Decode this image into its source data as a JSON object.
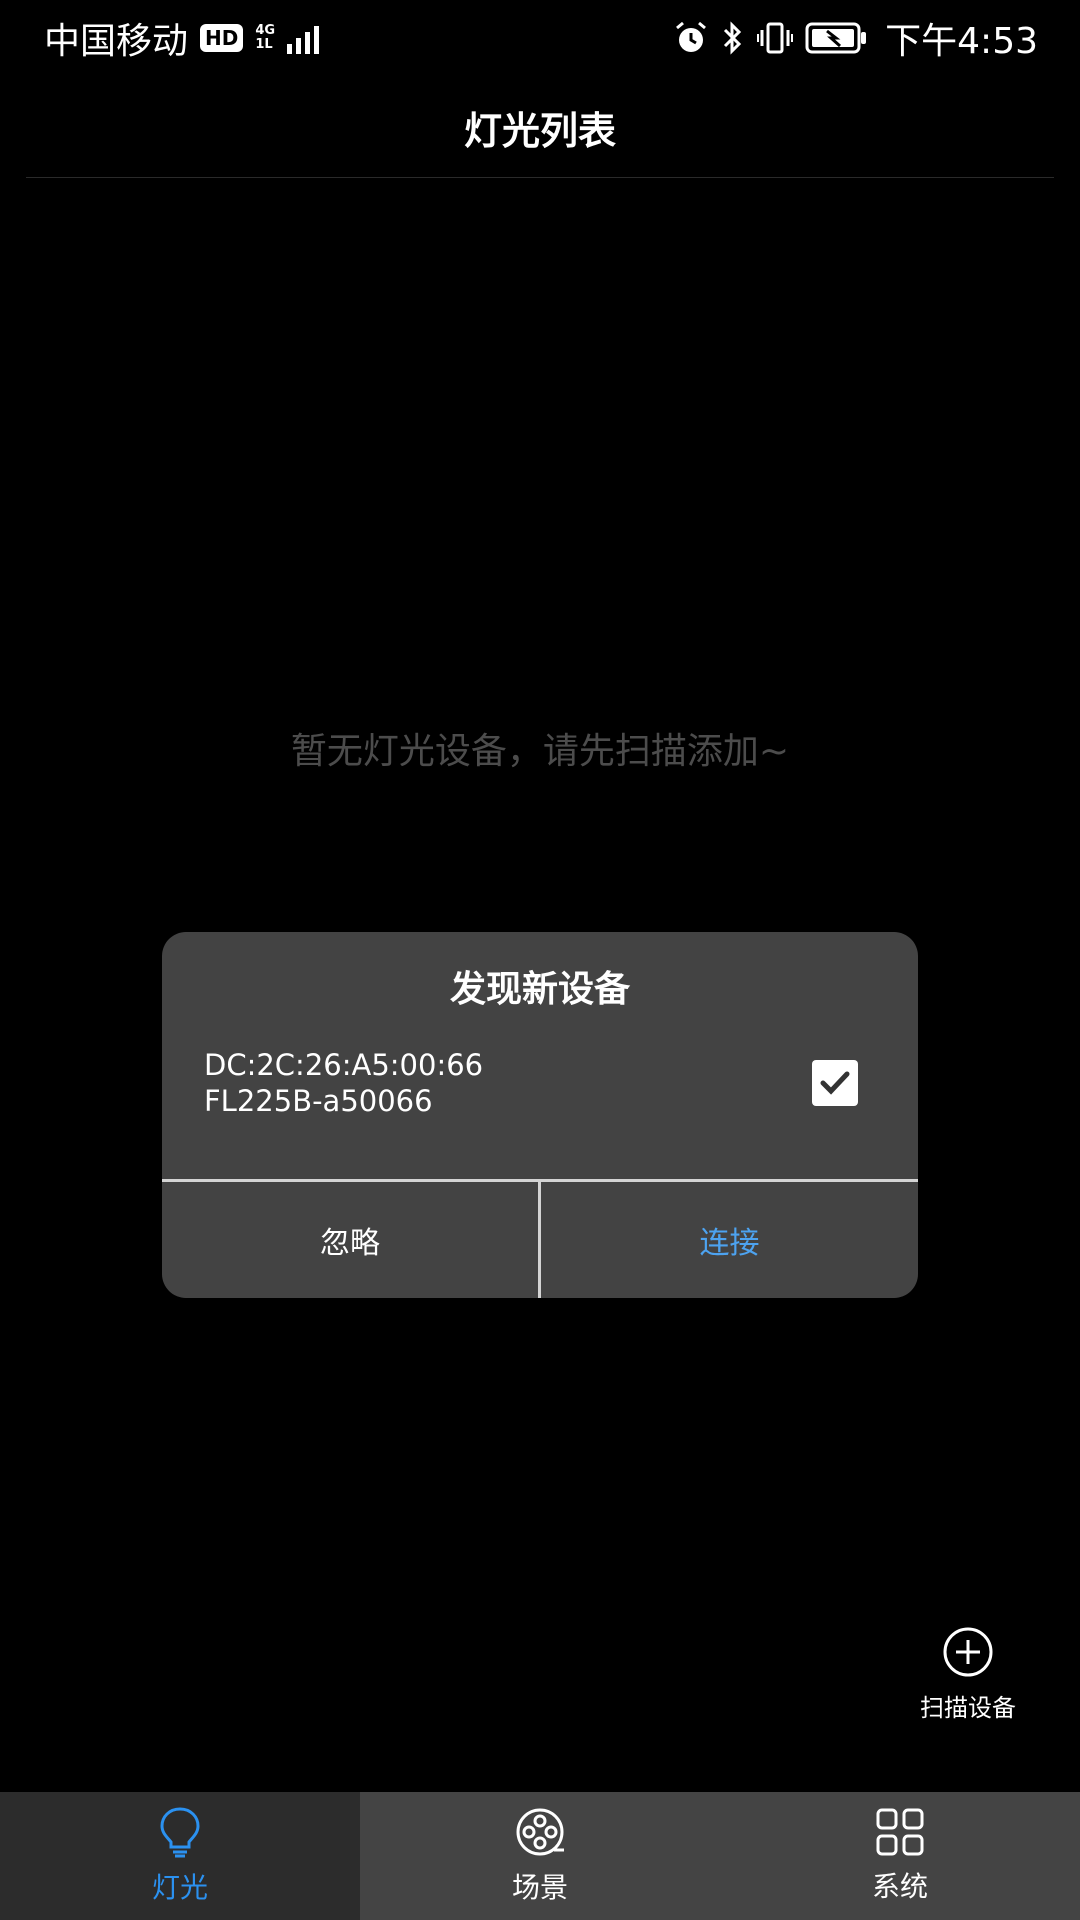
{
  "status_bar": {
    "carrier": "中国移动",
    "hd": "HD",
    "net_type_top": "4G",
    "net_type_bottom": "1L",
    "time": "下午4:53",
    "icons": [
      "alarm-icon",
      "bluetooth-icon",
      "vibrate-icon",
      "battery-icon"
    ]
  },
  "header": {
    "title": "灯光列表"
  },
  "empty_state": {
    "text": "暂无灯光设备，请先扫描添加~"
  },
  "dialog": {
    "title": "发现新设备",
    "device": {
      "mac": "DC:2C:26:A5:00:66",
      "name": "FL225B-a50066",
      "checked": true
    },
    "ignore_label": "忽略",
    "connect_label": "连接"
  },
  "scan": {
    "label": "扫描设备",
    "icon": "add-circle-icon"
  },
  "bottom_nav": {
    "items": [
      {
        "label": "灯光",
        "icon": "bulb-icon",
        "active": true
      },
      {
        "label": "场景",
        "icon": "film-reel-icon",
        "active": false
      },
      {
        "label": "系统",
        "icon": "grid-icon",
        "active": false
      }
    ]
  },
  "colors": {
    "accent": "#2b91f0",
    "connect": "#4da3f0",
    "dialog_bg": "#434343",
    "nav_bg": "#444444"
  }
}
